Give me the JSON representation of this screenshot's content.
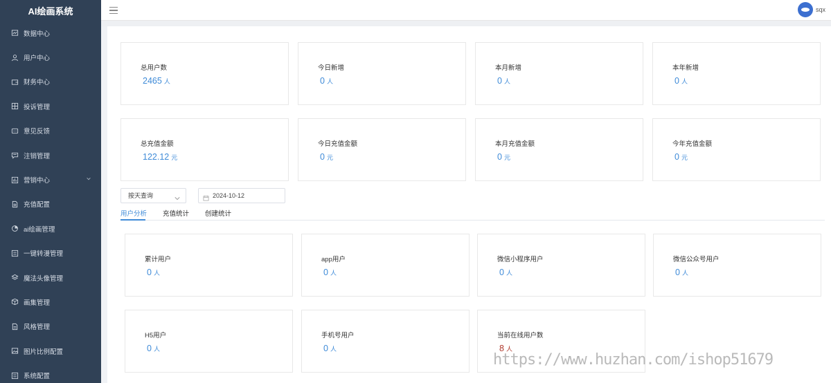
{
  "app": {
    "title": "AI绘画系统"
  },
  "sidebar": {
    "items": [
      {
        "label": "数据中心",
        "icon": "dashboard-icon"
      },
      {
        "label": "用户中心",
        "icon": "user-icon"
      },
      {
        "label": "财务中心",
        "icon": "wallet-icon"
      },
      {
        "label": "投诉管理",
        "icon": "grid-icon"
      },
      {
        "label": "意见反馈",
        "icon": "message-icon"
      },
      {
        "label": "注销管理",
        "icon": "chat-icon"
      },
      {
        "label": "营销中心",
        "icon": "chart-icon",
        "expandable": true
      },
      {
        "label": "充值配置",
        "icon": "file-icon"
      },
      {
        "label": "ai绘画管理",
        "icon": "pie-icon"
      },
      {
        "label": "一键转漫管理",
        "icon": "list-icon"
      },
      {
        "label": "魔法头像管理",
        "icon": "layers-icon"
      },
      {
        "label": "画集管理",
        "icon": "cube-icon"
      },
      {
        "label": "风格管理",
        "icon": "document-icon"
      },
      {
        "label": "图片比例配置",
        "icon": "image-icon"
      },
      {
        "label": "系统配置",
        "icon": "settings-icon"
      }
    ]
  },
  "header": {
    "username": "sqx"
  },
  "stats_row1": [
    {
      "label": "总用户数",
      "value": "2465",
      "unit": "人"
    },
    {
      "label": "今日新增",
      "value": "0",
      "unit": "人"
    },
    {
      "label": "本月新增",
      "value": "0",
      "unit": "人"
    },
    {
      "label": "本年新增",
      "value": "0",
      "unit": "人"
    }
  ],
  "stats_row2": [
    {
      "label": "总充值金额",
      "value": "122.12",
      "unit": "元"
    },
    {
      "label": "今日充值金额",
      "value": "0",
      "unit": "元"
    },
    {
      "label": "本月充值金额",
      "value": "0",
      "unit": "元"
    },
    {
      "label": "今年充值金额",
      "value": "0",
      "unit": "元"
    }
  ],
  "filter": {
    "query_mode": "按天查询",
    "date": "2024-10-12"
  },
  "tabs": [
    {
      "label": "用户分析",
      "active": true
    },
    {
      "label": "充值统计",
      "active": false
    },
    {
      "label": "创建统计",
      "active": false
    }
  ],
  "user_stats": [
    {
      "label": "累计用户",
      "value": "0",
      "unit": "人"
    },
    {
      "label": "app用户",
      "value": "0",
      "unit": "人"
    },
    {
      "label": "微信小程序用户",
      "value": "0",
      "unit": "人"
    },
    {
      "label": "微信公众号用户",
      "value": "0",
      "unit": "人"
    },
    {
      "label": "H5用户",
      "value": "0",
      "unit": "人"
    },
    {
      "label": "手机号用户",
      "value": "0",
      "unit": "人"
    },
    {
      "label": "当前在线用户数",
      "value": "8",
      "unit": "人"
    }
  ],
  "watermark": "https://www.huzhan.com/ishop51679",
  "colors": {
    "sidebar_bg": "#304156",
    "accent": "#3f8bd8",
    "online_value": "#b03a2e"
  }
}
